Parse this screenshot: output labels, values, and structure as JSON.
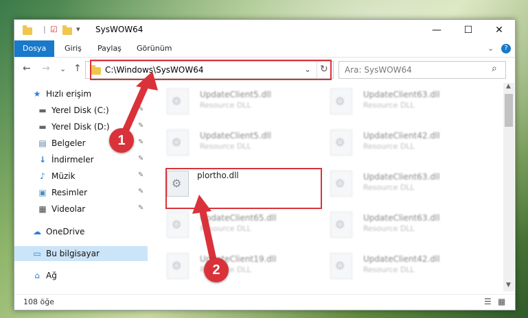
{
  "window": {
    "title": "SysWOW64",
    "controls": {
      "minimize": "—",
      "maximize": "☐",
      "close": "✕"
    }
  },
  "ribbon": {
    "tabs": [
      "Dosya",
      "Giriş",
      "Paylaş",
      "Görünüm"
    ],
    "help": "?"
  },
  "navigation": {
    "back": "←",
    "forward": "→",
    "recent": "⌄",
    "up": "↑",
    "address": "C:\\Windows\\SysWOW64",
    "dropdown": "⌄",
    "refresh": "↻",
    "search_placeholder": "Ara: SysWOW64",
    "search_icon": "⌕"
  },
  "sidebar": {
    "items": [
      {
        "label": "Hızlı erişim",
        "icon": "★",
        "pinned": false
      },
      {
        "label": "Yerel Disk (C:)",
        "icon": "▬",
        "pinned": true
      },
      {
        "label": "Yerel Disk (D:)",
        "icon": "▬",
        "pinned": true
      },
      {
        "label": "Belgeler",
        "icon": "▤",
        "pinned": true
      },
      {
        "label": "İndirmeler",
        "icon": "↓",
        "pinned": true
      },
      {
        "label": "Müzik",
        "icon": "♪",
        "pinned": true
      },
      {
        "label": "Resimler",
        "icon": "▣",
        "pinned": true
      },
      {
        "label": "Videolar",
        "icon": "▦",
        "pinned": true
      },
      {
        "label": "OneDrive",
        "icon": "☁",
        "pinned": false
      },
      {
        "label": "Bu bilgisayar",
        "icon": "▭",
        "pinned": false
      },
      {
        "label": "Ağ",
        "icon": "⌂",
        "pinned": false
      }
    ],
    "pin_glyph": "✎"
  },
  "files": [
    {
      "name": "UpdateClient5.dll",
      "type": "Resource DLL"
    },
    {
      "name": "UpdateClient63.dll",
      "type": "Resource DLL"
    },
    {
      "name": "UpdateClient5.dll",
      "type": "Resource DLL"
    },
    {
      "name": "UpdateClient42.dll",
      "type": "Resource DLL"
    },
    {
      "name": "plortho.dll",
      "type": ""
    },
    {
      "name": "UpdateClient63.dll",
      "type": "Resource DLL"
    },
    {
      "name": "UpdateClient65.dll",
      "type": "Resource DLL"
    },
    {
      "name": "UpdateClient63.dll",
      "type": "Resource DLL"
    },
    {
      "name": "UpdateClient19.dll",
      "type": "Resource DLL"
    },
    {
      "name": "UpdateClient42.dll",
      "type": "Resource DLL"
    }
  ],
  "status": {
    "item_count": "108 öğe"
  },
  "annotations": {
    "step1": "1",
    "step2": "2"
  },
  "colors": {
    "accent": "#1979ca",
    "highlight": "#d9323a"
  }
}
